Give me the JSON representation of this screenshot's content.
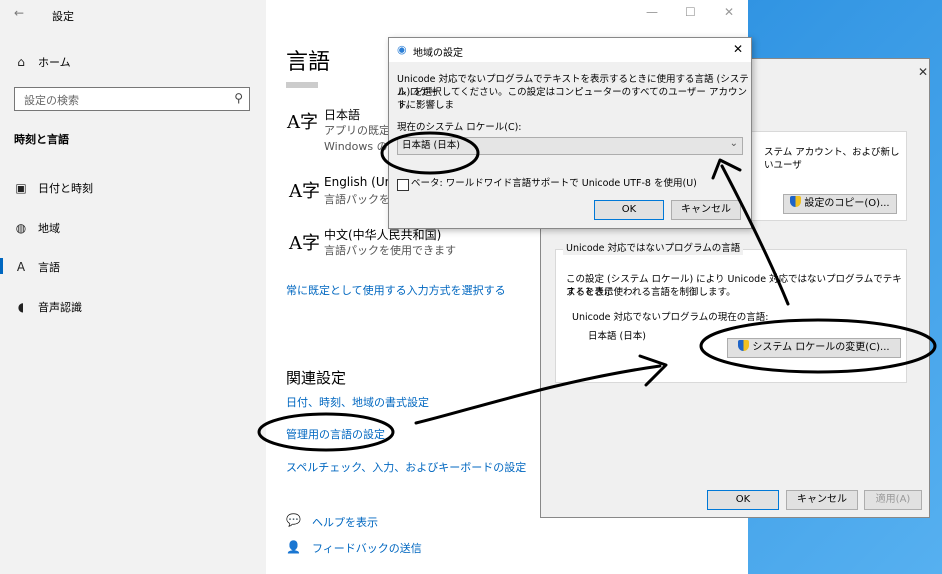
{
  "settings_window": {
    "title": "設定",
    "back_icon": "back-arrow-icon",
    "controls": [
      "—",
      "☐",
      "✕"
    ],
    "sidebar": {
      "home": "ホーム",
      "search_placeholder": "設定の検索",
      "section": "時刻と言語",
      "items": [
        {
          "label": "日付と時刻",
          "icon": "calendar-clock-icon"
        },
        {
          "label": "地域",
          "icon": "globe-region-icon"
        },
        {
          "label": "言語",
          "icon": "language-icon",
          "selected": true
        },
        {
          "label": "音声認識",
          "icon": "microphone-icon"
        }
      ]
    },
    "main": {
      "heading": "言語",
      "languages": [
        {
          "name": "日本語",
          "desc1": "アプリの既定の",
          "desc2": "Windows の"
        },
        {
          "name": "English (Unit",
          "desc1": "言語パックをイ"
        },
        {
          "name": "中文(中华人民共和国)",
          "desc1": "言語パックを使用できます"
        }
      ],
      "input_link": "常に既定として使用する入力方式を選択する",
      "related_heading": "関連設定",
      "related_links": [
        "日付、時刻、地域の書式設定",
        "管理用の言語の設定",
        "スペルチェック、入力、およびキーボードの設定"
      ],
      "help": "ヘルプを表示",
      "feedback": "フィードバックの送信"
    }
  },
  "region_dialog": {
    "close": "✕",
    "top_group_text": "ステム アカウント、および新しいユーザ",
    "copy_button": "設定のコピー(O)...",
    "group_title": "Unicode 対応ではないプログラムの言語",
    "desc_line1": "この設定 (システム ロケール) により Unicode 対応ではないプログラムでテキストを表示",
    "desc_line2": "するときに使われる言語を制御します。",
    "current_label": "Unicode 対応でないプログラムの現在の言語:",
    "current_value": "日本語 (日本)",
    "change_button": "システム ロケールの変更(C)...",
    "ok": "OK",
    "cancel": "キャンセル",
    "apply": "適用(A)"
  },
  "locale_dialog": {
    "title": "地域の設定",
    "close": "✕",
    "desc_line1": "Unicode 対応でないプログラムでテキストを表示するときに使用する言語 (システム ロケー",
    "desc_line2": "ル) を選択してください。この設定はコンピューターのすべてのユーザー アカウントに影響しま",
    "desc_line3": "す。",
    "current_label": "現在のシステム ロケール(C):",
    "selected_value": "日本語 (日本)",
    "checkbox_label": "ベータ: ワールドワイド言語サポートで Unicode UTF-8 を使用(U)",
    "ok": "OK",
    "cancel": "キャンセル"
  }
}
